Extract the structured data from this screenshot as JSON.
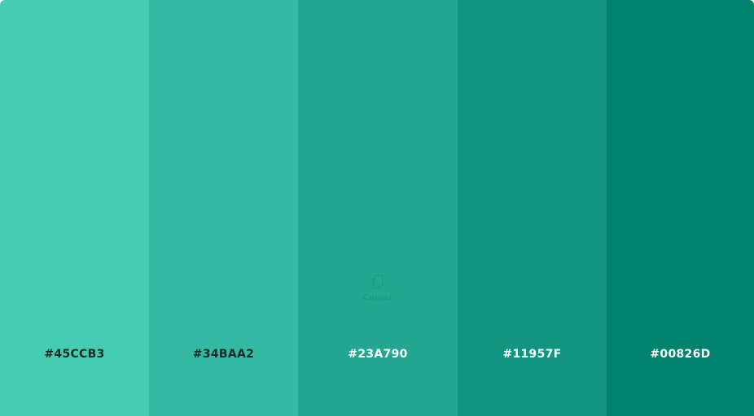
{
  "palette": {
    "swatches": [
      {
        "hex": "#45CCB3",
        "color": "#45CCB3",
        "text_color": "#1B2A27"
      },
      {
        "hex": "#34BAA2",
        "color": "#34BAA2",
        "text_color": "#1B2A27"
      },
      {
        "hex": "#23A790",
        "color": "#23A790",
        "text_color": "#FFFFFF"
      },
      {
        "hex": "#11957F",
        "color": "#11957F",
        "text_color": "#FFFFFF"
      },
      {
        "hex": "#00826D",
        "color": "#00826D",
        "text_color": "#FFFFFF"
      }
    ],
    "copy_hint": {
      "label": "Copiar",
      "icon": "clipboard-icon",
      "color": "#15937E"
    }
  }
}
